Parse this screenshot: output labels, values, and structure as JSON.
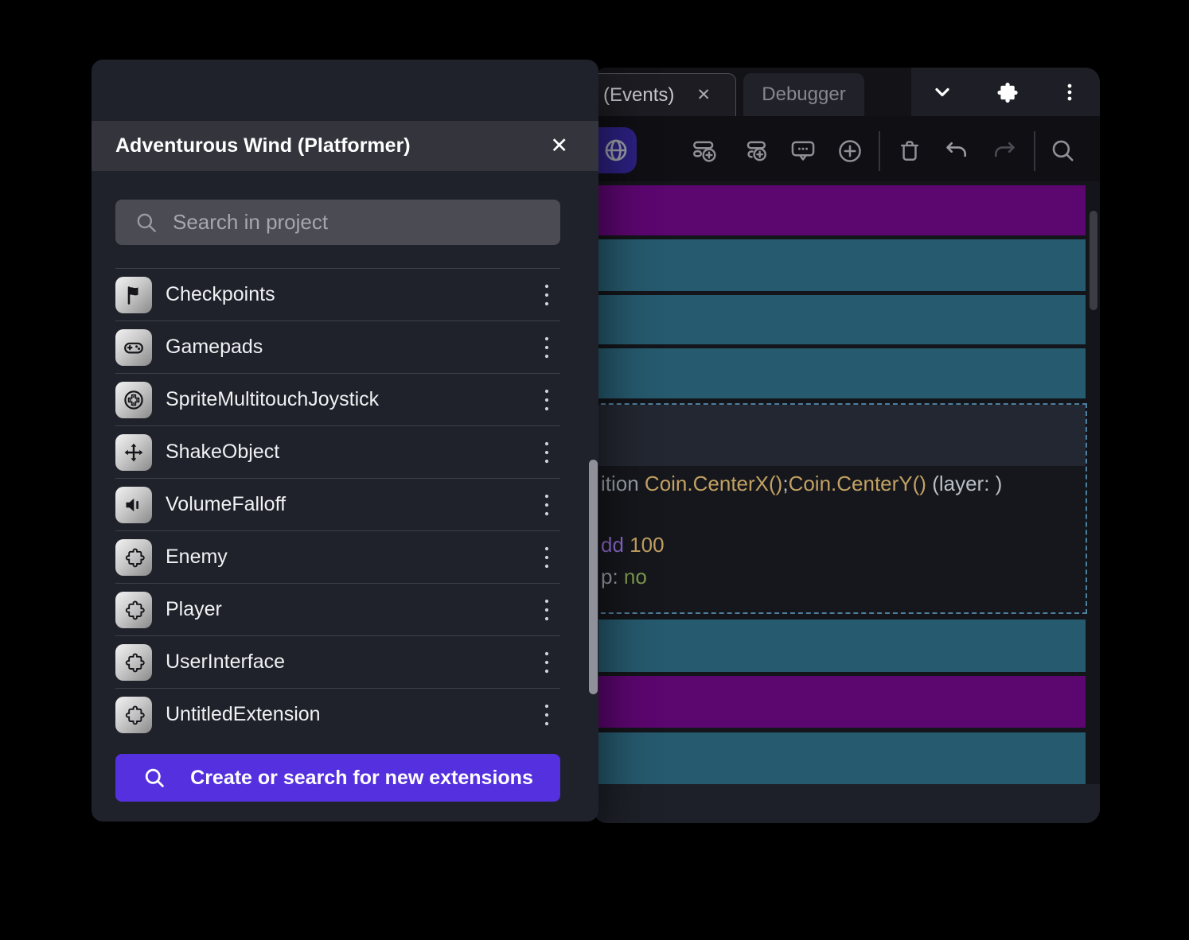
{
  "dialog": {
    "title": "Adventurous Wind (Platformer)",
    "close_glyph": "✕",
    "search_placeholder": "Search in project",
    "extensions": [
      {
        "label": "Checkpoints",
        "icon": "flag-icon"
      },
      {
        "label": "Gamepads",
        "icon": "gamepad-icon"
      },
      {
        "label": "SpriteMultitouchJoystick",
        "icon": "joystick-icon"
      },
      {
        "label": "ShakeObject",
        "icon": "move-arrows-icon"
      },
      {
        "label": "VolumeFalloff",
        "icon": "volume-icon"
      },
      {
        "label": "Enemy",
        "icon": "puzzle-icon"
      },
      {
        "label": "Player",
        "icon": "puzzle-icon"
      },
      {
        "label": "UserInterface",
        "icon": "puzzle-icon"
      },
      {
        "label": "UntitledExtension",
        "icon": "puzzle-icon"
      }
    ],
    "create_button_label": "Create or search for new extensions"
  },
  "editor": {
    "tabs": [
      {
        "label": "(Events)",
        "close_glyph": "✕",
        "active": true
      },
      {
        "label": "Debugger",
        "active": false
      }
    ],
    "tabbar_icons": [
      "chevron-down-icon",
      "puzzle-icon",
      "kebab-menu-icon"
    ],
    "toolbar_icons": [
      "globe-icon",
      "add-event-icon",
      "add-subevent-icon",
      "add-comment-icon",
      "circle-plus-icon",
      "trash-icon",
      "undo-icon",
      "redo-icon",
      "search-icon"
    ],
    "event_code": {
      "line1": {
        "pre": "ition ",
        "fn1": "Coin.CenterX()",
        "sep": ";",
        "fn2": "Coin.CenterY()",
        "post": " (layer: )"
      },
      "line2": {
        "kw": "dd ",
        "val": "100"
      },
      "line3": {
        "key": "p: ",
        "val": "no"
      }
    },
    "colors": {
      "event_purple": "#5c0670",
      "event_teal": "#265a6e",
      "selection_border": "#4e7f9f",
      "toolbar_accent_indigo": "#2c2080",
      "create_button_purple": "#5430df",
      "token_tan": "#c2a163",
      "token_purple": "#8f6cd0",
      "token_green": "#7e9c4e"
    }
  }
}
